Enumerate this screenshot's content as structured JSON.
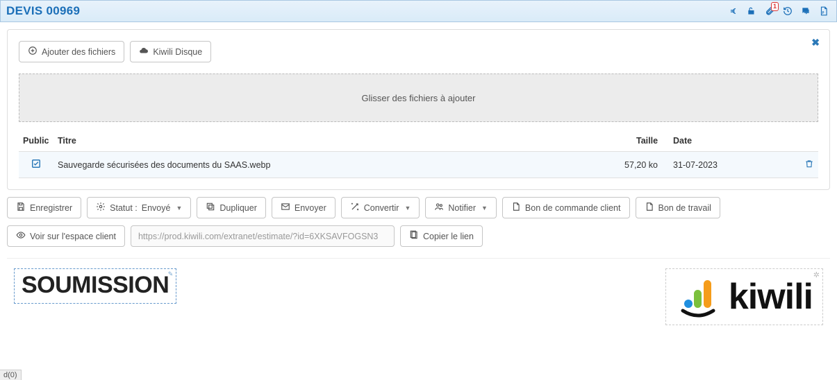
{
  "header": {
    "title": "DEVIS 00969",
    "attachment_badge": "1"
  },
  "files_panel": {
    "add_files_label": "Ajouter des fichiers",
    "kiwili_disk_label": "Kiwili Disque",
    "dropzone_label": "Glisser des fichiers à ajouter",
    "columns": {
      "public": "Public",
      "title": "Titre",
      "size": "Taille",
      "date": "Date"
    },
    "rows": [
      {
        "public_checked": true,
        "title": "Sauvegarde sécurisées des documents du SAAS.webp",
        "size": "57,20 ko",
        "date": "31-07-2023"
      }
    ]
  },
  "actions": {
    "save": "Enregistrer",
    "status_prefix": "Statut : ",
    "status_value": "Envoyé",
    "duplicate": "Dupliquer",
    "send": "Envoyer",
    "convert": "Convertir",
    "notify": "Notifier",
    "purchase_order": "Bon de commande client",
    "work_order": "Bon de travail"
  },
  "link_row": {
    "view_client_space": "Voir sur l'espace client",
    "url": "https://prod.kiwili.com/extranet/estimate/?id=6XKSAVFOGSN3",
    "copy": "Copier le lien"
  },
  "preview": {
    "soumission": "SOUMISSION",
    "logo_word": "kiwili"
  },
  "footer": {
    "d0": "d(0)"
  }
}
